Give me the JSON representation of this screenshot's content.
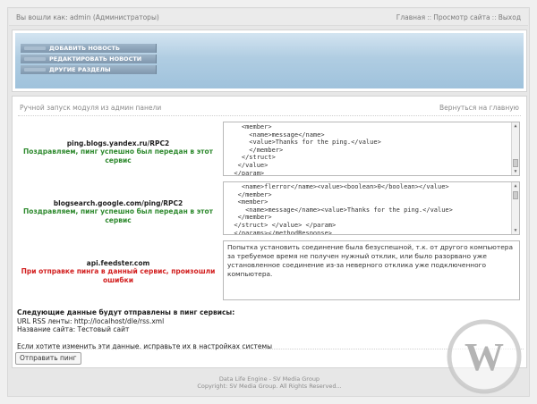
{
  "topbar": {
    "login_text": "Вы вошли как: admin (Администраторы)",
    "links": [
      "Главная",
      "Просмотр сайта",
      "Выход"
    ]
  },
  "menu": {
    "items": [
      "ДОБАВИТЬ НОВОСТЬ",
      "РЕДАКТИРОВАТЬ НОВОСТИ",
      "ДРУГИЕ РАЗДЕЛЫ"
    ]
  },
  "panel": {
    "title": "Ручной запуск модуля из админ панели",
    "back_link": "Вернуться на главную"
  },
  "services": [
    {
      "name": "ping.blogs.yandex.ru/RPC2",
      "status": "Поздравляем, пинг успешно был передан в этот сервис",
      "status_type": "success",
      "response": "    <member>\n      <name>message</name>\n      <value>Thanks for the ping.</value>\n      </member>\n    </struct>\n   </value>\n  </param>\n  </params>"
    },
    {
      "name": "blogsearch.google.com/ping/RPC2",
      "status": "Поздравляем, пинг успешно был передан в этот сервис",
      "status_type": "success",
      "response": "    <name>flerror</name><value><boolean>0</boolean></value>\n   </member>\n   <member>\n     <name>message</name><value>Thanks for the ping.</value>\n   </member>\n  </struct> </value> </param>\n  </params></methodResponse>"
    },
    {
      "name": "api.feedster.com",
      "status": "При отправке пинга в данный сервис, произошли ошибки",
      "status_type": "error",
      "response": "Попытка установить соединение была безуспешной, т.к. от другого компьютера за требуемое время не получен нужный отклик, или было разорвано уже установленное соединение из-за неверного отклика уже подключенного компьютера."
    }
  ],
  "summary": {
    "heading": "Следующие данные будут отправлены в пинг сервисы:",
    "rss_line": "URL RSS ленты: http://localhost/dle/rss.xml",
    "site_line": "Название сайта: Тестовый сайт",
    "note": "Если хотите изменить эти данные, исправьте их в настройках системы"
  },
  "button": {
    "label": "Отправить пинг"
  },
  "footer": {
    "line1": "Data Life Engine - SV Media Group",
    "line2": "Copyright: SV Media Group. All Rights Reserved..."
  },
  "watermark": {
    "letter": "W",
    "color": "#b4b4b4"
  }
}
